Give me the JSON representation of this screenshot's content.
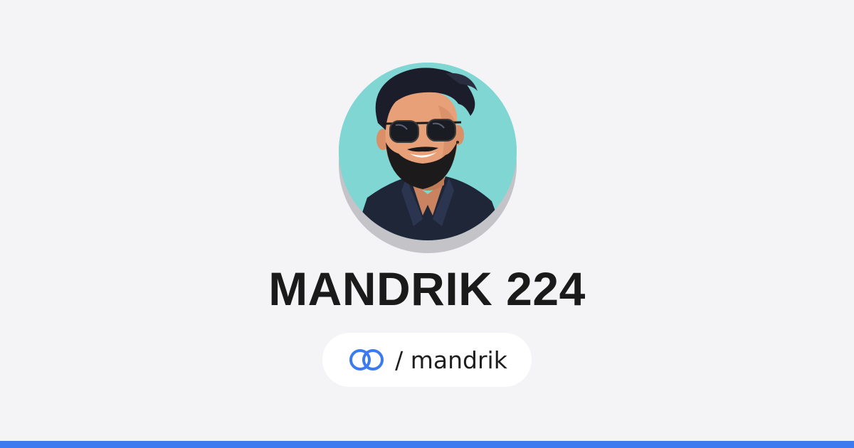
{
  "profile": {
    "display_name": "MANDRIK 224",
    "handle": "/ mandrik",
    "avatar": "avatar-portrait-illustration",
    "brand_icon": "linked-circles-icon"
  },
  "colors": {
    "background": "#f4f4f6",
    "accent": "#3b7af0",
    "avatar_background": "#7fd6d3",
    "text": "#1a1a1a"
  }
}
